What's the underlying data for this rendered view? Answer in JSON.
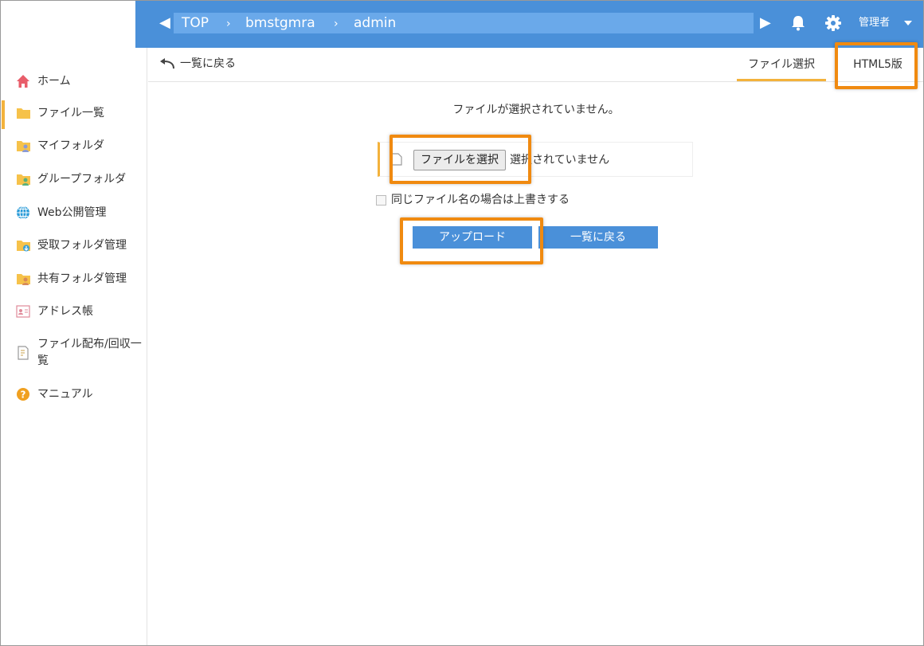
{
  "header": {
    "breadcrumbs": [
      "TOP",
      "bmstgmra",
      "admin"
    ],
    "separator": "›",
    "user_label": "管理者"
  },
  "sidebar": {
    "items": [
      {
        "label": "ホーム",
        "icon": "home-icon"
      },
      {
        "label": "ファイル一覧",
        "icon": "folder-icon",
        "active": true
      },
      {
        "label": "マイフォルダ",
        "icon": "my-folder-icon"
      },
      {
        "label": "グループフォルダ",
        "icon": "group-folder-icon"
      },
      {
        "label": "Web公開管理",
        "icon": "globe-icon"
      },
      {
        "label": "受取フォルダ管理",
        "icon": "receive-folder-icon"
      },
      {
        "label": "共有フォルダ管理",
        "icon": "shared-folder-icon"
      },
      {
        "label": "アドレス帳",
        "icon": "address-book-icon"
      },
      {
        "label": "ファイル配布/回収一",
        "label_line2": "覧",
        "icon": "distribution-icon"
      },
      {
        "label": "マニュアル",
        "icon": "help-icon"
      }
    ]
  },
  "toolbar": {
    "back_label": "一覧に戻る",
    "tabs": [
      {
        "label": "ファイル選択",
        "active": true
      },
      {
        "label": "HTML5版",
        "active": false
      }
    ]
  },
  "main": {
    "status_message": "ファイルが選択されていません。",
    "file_button_label": "ファイルを選択",
    "file_status": "選択されていません",
    "overwrite_label": "同じファイル名の場合は上書きする",
    "upload_label": "アップロード",
    "back_button_label": "一覧に戻る"
  },
  "colors": {
    "header_blue": "#4a90d9",
    "accent_yellow": "#f3b23c",
    "highlight_orange": "#f08a10"
  }
}
